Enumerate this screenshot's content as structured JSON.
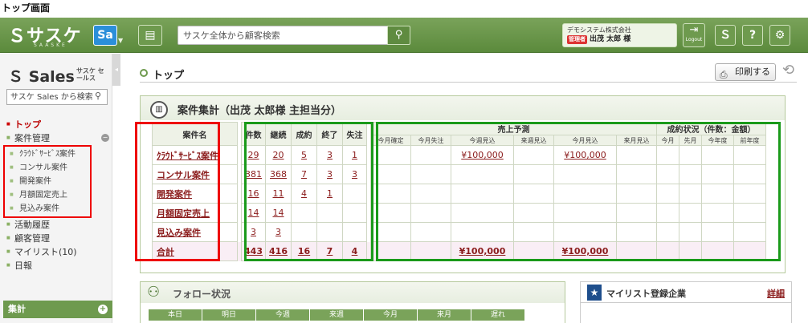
{
  "page_caption": "トップ画面",
  "topbar": {
    "logo": "サスケ",
    "logo_sub": "SAASKE",
    "app_badge": "Sa",
    "search_placeholder": "サスケ全体から顧客検索",
    "company": "デモシステム株式会社",
    "role": "管理者",
    "user": "出茂 太郎 様",
    "logout": "Logout"
  },
  "sidebar": {
    "title": "Sales",
    "title_kana": "サスケ セールス",
    "search_placeholder": "サスケ Sales から検索",
    "nav_top": "トップ",
    "nav_case": "案件管理",
    "sub_items": [
      "ｸﾗｳﾄﾞｻｰﾋﾞｽ案件",
      "コンサル案件",
      "開発案件",
      "月額固定売上",
      "見込み案件"
    ],
    "nav_rest": [
      "活動履歴",
      "顧客管理",
      "マイリスト(10)",
      "日報"
    ],
    "sum_label": "集計"
  },
  "main": {
    "breadcrumb": "トップ",
    "print_label": "印刷する",
    "panel_title": "案件集計（出茂 太郎様 主担当分）",
    "headers": {
      "name": "案件名",
      "cols": [
        "件数",
        "継続",
        "成約",
        "終了",
        "失注"
      ],
      "forecast_group": "売上予測",
      "forecast_cols": [
        "今月確定",
        "今月失注",
        "今週見込",
        "来週見込",
        "今月見込",
        "来月見込"
      ],
      "status_group": "成約状況（件数：金額）",
      "status_cols": [
        "今月",
        "先月",
        "今年度",
        "前年度"
      ]
    },
    "rows": [
      {
        "name": "ｸﾗｳﾄﾞｻｰﾋﾞｽ案件",
        "c": [
          "29",
          "20",
          "5",
          "3",
          "1"
        ],
        "week": "¥100,000",
        "month": "¥100,000"
      },
      {
        "name": "コンサル案件",
        "c": [
          "381",
          "368",
          "7",
          "3",
          "3"
        ],
        "week": "",
        "month": ""
      },
      {
        "name": "開発案件",
        "c": [
          "16",
          "11",
          "4",
          "1",
          ""
        ],
        "week": "",
        "month": ""
      },
      {
        "name": "月額固定売上",
        "c": [
          "14",
          "14",
          "",
          "",
          ""
        ],
        "week": "",
        "month": ""
      },
      {
        "name": "見込み案件",
        "c": [
          "3",
          "3",
          "",
          "",
          ""
        ],
        "week": "",
        "month": ""
      }
    ],
    "total": {
      "name": "合計",
      "c": [
        "443",
        "416",
        "16",
        "7",
        "4"
      ],
      "week": "¥100,000",
      "month": "¥100,000"
    },
    "follow_title": "フォロー状況",
    "follow_cols": [
      "本日",
      "明日",
      "今週",
      "来週",
      "今月",
      "来月",
      "遅れ"
    ],
    "mylist_title": "マイリスト登録企業",
    "mylist_detail": "詳細"
  }
}
